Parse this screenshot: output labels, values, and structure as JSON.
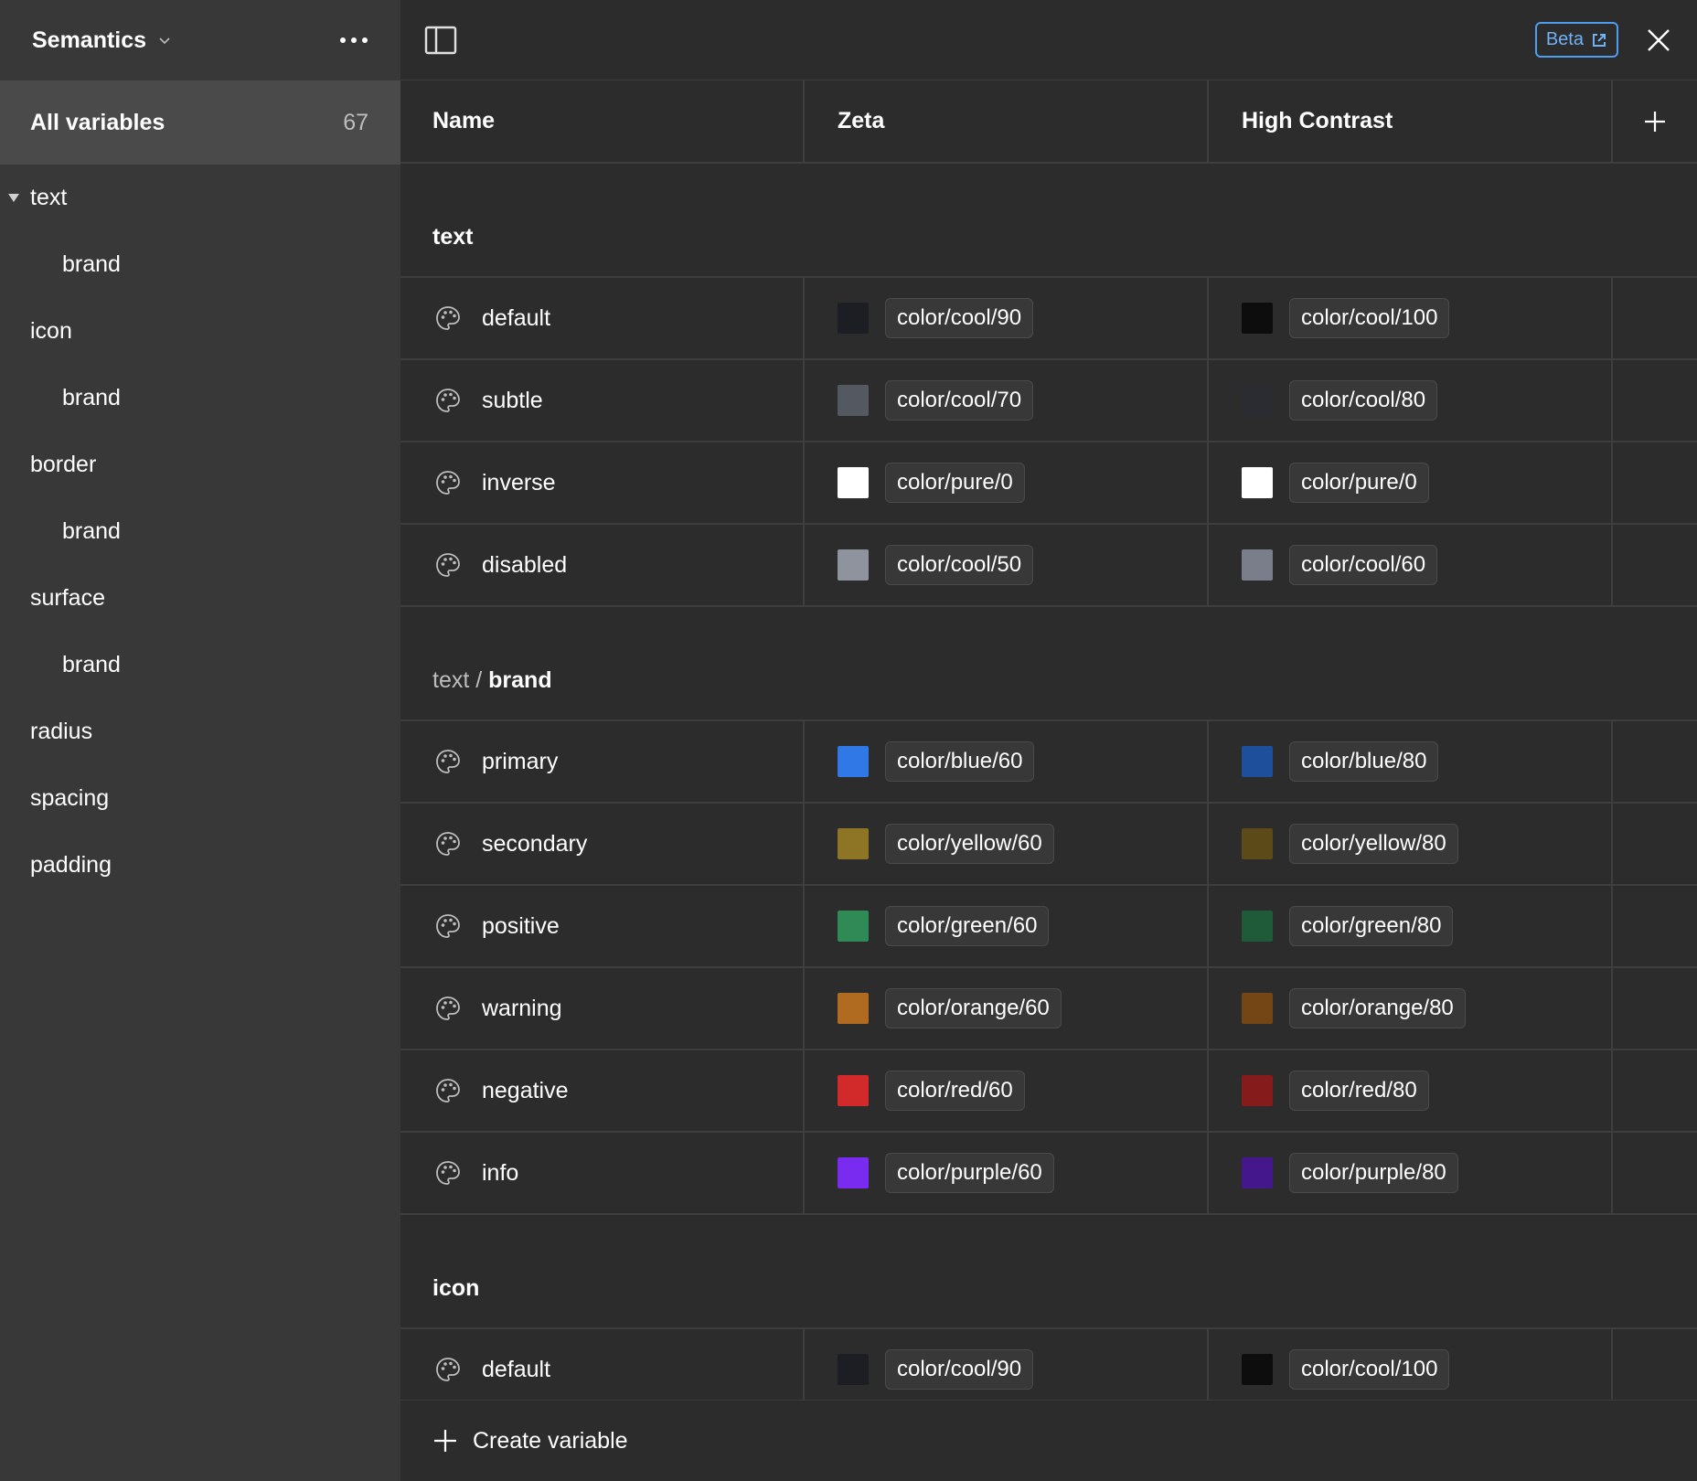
{
  "sidebar": {
    "collection": "Semantics",
    "all_variables": {
      "label": "All variables",
      "count": "67"
    },
    "groups": [
      {
        "label": "text",
        "child": false,
        "expanded": true
      },
      {
        "label": "brand",
        "child": true
      },
      {
        "label": "icon",
        "child": false
      },
      {
        "label": "brand",
        "child": true
      },
      {
        "label": "border",
        "child": false
      },
      {
        "label": "brand",
        "child": true
      },
      {
        "label": "surface",
        "child": false
      },
      {
        "label": "brand",
        "child": true
      },
      {
        "label": "radius",
        "child": false
      },
      {
        "label": "spacing",
        "child": false
      },
      {
        "label": "padding",
        "child": false
      }
    ]
  },
  "topbar": {
    "beta": "Beta"
  },
  "columns": {
    "name": "Name",
    "zeta": "Zeta",
    "high_contrast": "High Contrast"
  },
  "sections": [
    {
      "path": "",
      "title": "text",
      "rows": [
        {
          "name": "default",
          "zeta": {
            "swatch": "#1c1e24",
            "value": "color/cool/90"
          },
          "hc": {
            "swatch": "#0d0d0e",
            "value": "color/cool/100"
          }
        },
        {
          "name": "subtle",
          "zeta": {
            "swatch": "#545961",
            "value": "color/cool/70"
          },
          "hc": {
            "swatch": "#2a2c31",
            "value": "color/cool/80"
          }
        },
        {
          "name": "inverse",
          "zeta": {
            "swatch": "#ffffff",
            "value": "color/pure/0"
          },
          "hc": {
            "swatch": "#ffffff",
            "value": "color/pure/0"
          }
        },
        {
          "name": "disabled",
          "zeta": {
            "swatch": "#8f939e",
            "value": "color/cool/50"
          },
          "hc": {
            "swatch": "#7a7e8a",
            "value": "color/cool/60"
          }
        }
      ]
    },
    {
      "path": "text / ",
      "title": "brand",
      "rows": [
        {
          "name": "primary",
          "zeta": {
            "swatch": "#2f78e6",
            "value": "color/blue/60"
          },
          "hc": {
            "swatch": "#1d4f9a",
            "value": "color/blue/80"
          }
        },
        {
          "name": "secondary",
          "zeta": {
            "swatch": "#8e7425",
            "value": "color/yellow/60"
          },
          "hc": {
            "swatch": "#5c4b18",
            "value": "color/yellow/80"
          }
        },
        {
          "name": "positive",
          "zeta": {
            "swatch": "#2f8a55",
            "value": "color/green/60"
          },
          "hc": {
            "swatch": "#1f5b38",
            "value": "color/green/80"
          }
        },
        {
          "name": "warning",
          "zeta": {
            "swatch": "#b06b20",
            "value": "color/orange/60"
          },
          "hc": {
            "swatch": "#744515",
            "value": "color/orange/80"
          }
        },
        {
          "name": "negative",
          "zeta": {
            "swatch": "#d22a2a",
            "value": "color/red/60"
          },
          "hc": {
            "swatch": "#861b1b",
            "value": "color/red/80"
          }
        },
        {
          "name": "info",
          "zeta": {
            "swatch": "#7a2bf0",
            "value": "color/purple/60"
          },
          "hc": {
            "swatch": "#45178d",
            "value": "color/purple/80"
          }
        }
      ]
    },
    {
      "path": "",
      "title": "icon",
      "rows": [
        {
          "name": "default",
          "zeta": {
            "swatch": "#1c1e24",
            "value": "color/cool/90"
          },
          "hc": {
            "swatch": "#0d0d0e",
            "value": "color/cool/100"
          }
        }
      ]
    }
  ],
  "footer": {
    "create": "Create variable"
  }
}
